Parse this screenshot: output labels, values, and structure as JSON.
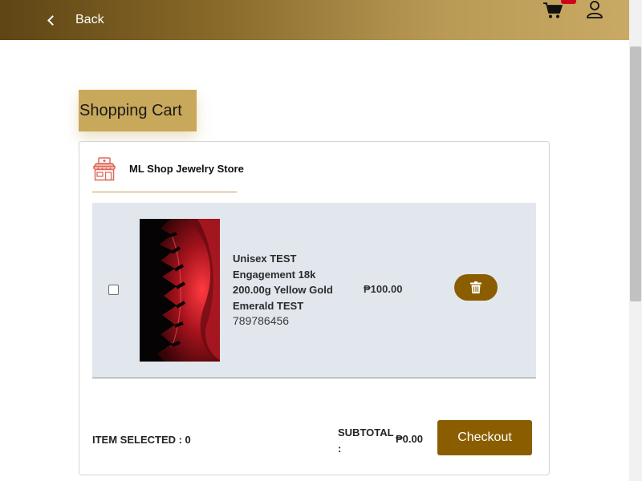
{
  "header": {
    "back_label": "Back",
    "cart_icon": "cart-icon",
    "user_icon": "user-icon",
    "accent": "#8a5e00",
    "badge_color": "#d0021b"
  },
  "page": {
    "title": "Shopping Cart"
  },
  "store": {
    "name": "ML Shop Jewelry Store",
    "icon": "store-icon"
  },
  "cart_items": [
    {
      "name": "Unisex TEST Engagement 18k 200.00g Yellow Gold Emerald TEST",
      "sku": "789786456",
      "price": "₱100.00",
      "selected": false
    }
  ],
  "summary": {
    "item_selected_label": "ITEM SELECTED : 0",
    "subtotal_label": "SUBTOTAL :",
    "subtotal_value": "₱0.00",
    "checkout_label": "Checkout"
  }
}
